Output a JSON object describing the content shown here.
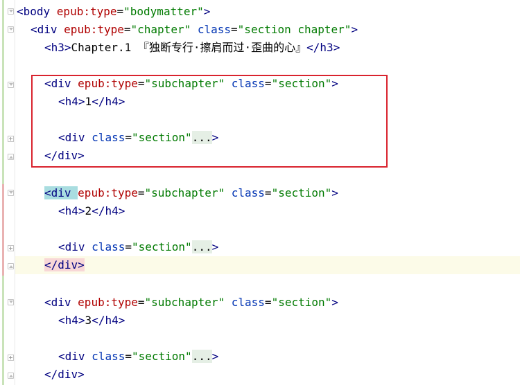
{
  "editor": {
    "lines": [
      {
        "id": "l1",
        "segments": [
          [
            "t",
            "<body "
          ],
          [
            "a",
            "epub:type"
          ],
          [
            "b",
            "="
          ],
          [
            "v",
            "\"bodymatter\""
          ],
          [
            "t",
            ">"
          ]
        ]
      },
      {
        "id": "l2",
        "segments": [
          [
            "t",
            "<div "
          ],
          [
            "a",
            "epub:type"
          ],
          [
            "b",
            "="
          ],
          [
            "v",
            "\"chapter\""
          ],
          [
            "b",
            " "
          ],
          [
            "attr2",
            "class"
          ],
          [
            "b",
            "="
          ],
          [
            "v",
            "\"section chapter\""
          ],
          [
            "t",
            ">"
          ]
        ]
      },
      {
        "id": "l3",
        "segments": [
          [
            "t",
            "<h3"
          ],
          [
            "t",
            ">"
          ],
          [
            "b",
            "Chapter.1 『独断专行·擦肩而过·歪曲的心』"
          ],
          [
            "t",
            "</h3>"
          ]
        ]
      },
      {
        "id": "l4",
        "segments": []
      },
      {
        "id": "l5",
        "segments": [
          [
            "t",
            "<div "
          ],
          [
            "a",
            "epub:type"
          ],
          [
            "b",
            "="
          ],
          [
            "v",
            "\"subchapter\""
          ],
          [
            "b",
            " "
          ],
          [
            "attr2",
            "class"
          ],
          [
            "b",
            "="
          ],
          [
            "v",
            "\"section\""
          ],
          [
            "t",
            ">"
          ]
        ]
      },
      {
        "id": "l6",
        "segments": [
          [
            "t",
            "<h4"
          ],
          [
            "t",
            ">"
          ],
          [
            "b",
            "1"
          ],
          [
            "t",
            "</h4>"
          ]
        ]
      },
      {
        "id": "l7",
        "segments": []
      },
      {
        "id": "l8",
        "segments": [
          [
            "t",
            "<div "
          ],
          [
            "attr2",
            "class"
          ],
          [
            "b",
            "="
          ],
          [
            "v",
            "\"section\""
          ],
          [
            "ell",
            "..."
          ],
          [
            "t",
            ">"
          ]
        ]
      },
      {
        "id": "l9",
        "segments": [
          [
            "t",
            "</div>"
          ]
        ]
      },
      {
        "id": "l10",
        "segments": []
      },
      {
        "id": "l11",
        "segments": [
          [
            "t",
            "<div "
          ],
          [
            "a",
            "epub:type"
          ],
          [
            "b",
            "="
          ],
          [
            "v",
            "\"subchapter\""
          ],
          [
            "b",
            " "
          ],
          [
            "attr2",
            "class"
          ],
          [
            "b",
            "="
          ],
          [
            "v",
            "\"section\""
          ],
          [
            "t",
            ">"
          ]
        ]
      },
      {
        "id": "l12",
        "segments": [
          [
            "t",
            "<h4"
          ],
          [
            "t",
            ">"
          ],
          [
            "b",
            "2"
          ],
          [
            "t",
            "</h4>"
          ]
        ]
      },
      {
        "id": "l13",
        "segments": []
      },
      {
        "id": "l14",
        "segments": [
          [
            "t",
            "<div "
          ],
          [
            "attr2",
            "class"
          ],
          [
            "b",
            "="
          ],
          [
            "v",
            "\"section\""
          ],
          [
            "ell",
            "..."
          ],
          [
            "t",
            ">"
          ]
        ]
      },
      {
        "id": "l15",
        "segments": [
          [
            "t",
            "</div>"
          ]
        ]
      },
      {
        "id": "l16",
        "segments": []
      },
      {
        "id": "l17",
        "segments": [
          [
            "t",
            "<div "
          ],
          [
            "a",
            "epub:type"
          ],
          [
            "b",
            "="
          ],
          [
            "v",
            "\"subchapter\""
          ],
          [
            "b",
            " "
          ],
          [
            "attr2",
            "class"
          ],
          [
            "b",
            "="
          ],
          [
            "v",
            "\"section\""
          ],
          [
            "t",
            ">"
          ]
        ]
      },
      {
        "id": "l18",
        "segments": [
          [
            "t",
            "<h4"
          ],
          [
            "t",
            ">"
          ],
          [
            "b",
            "3"
          ],
          [
            "t",
            "</h4>"
          ]
        ]
      },
      {
        "id": "l19",
        "segments": []
      },
      {
        "id": "l20",
        "segments": [
          [
            "t",
            "<div "
          ],
          [
            "attr2",
            "class"
          ],
          [
            "b",
            "="
          ],
          [
            "v",
            "\"section\""
          ],
          [
            "ell",
            "..."
          ],
          [
            "t",
            ">"
          ]
        ]
      },
      {
        "id": "l21",
        "segments": [
          [
            "t",
            "</div>"
          ]
        ]
      }
    ]
  },
  "colors": {
    "tag": "#000080",
    "attribute": "#b00000",
    "value": "#007a00",
    "highlight_box": "#d9232e",
    "current_line": "#fcfbe8"
  }
}
